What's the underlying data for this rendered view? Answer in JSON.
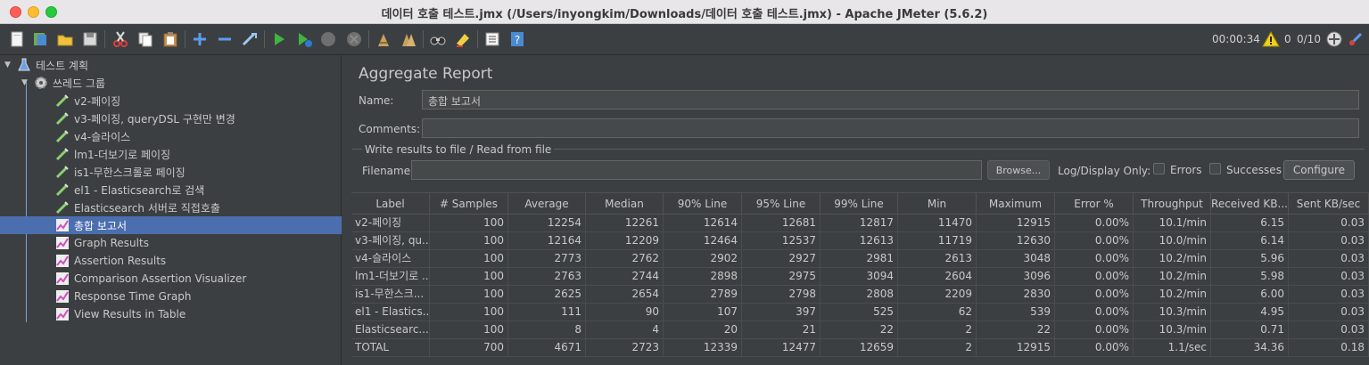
{
  "window": {
    "title": "데이터 호출 테스트.jmx (/Users/inyongkim/Downloads/데이터 호출 테스트.jmx) - Apache JMeter (5.6.2)"
  },
  "toolbar": {
    "timer": "00:00:34",
    "warning_count": "0",
    "threads": "0/10"
  },
  "tree": {
    "items": [
      {
        "label": "테스트 계획",
        "icon": "flask-icon"
      },
      {
        "label": "쓰레드 그룹",
        "icon": "gear-icon"
      },
      {
        "label": "v2-페이징",
        "icon": "sampler-pipette-icon"
      },
      {
        "label": "v3-페이징, queryDSL 구현만 변경",
        "icon": "sampler-pipette-icon"
      },
      {
        "label": "v4-슬라이스",
        "icon": "sampler-pipette-icon"
      },
      {
        "label": "lm1-더보기로 페이징",
        "icon": "sampler-pipette-icon"
      },
      {
        "label": "is1-무한스크롤로 페이징",
        "icon": "sampler-pipette-icon"
      },
      {
        "label": "el1 - Elasticsearch로 검색",
        "icon": "sampler-pipette-icon"
      },
      {
        "label": "Elasticsearch 서버로 직접호출",
        "icon": "sampler-pipette-icon"
      },
      {
        "label": "총합 보고서",
        "icon": "listener-chart-icon"
      },
      {
        "label": "Graph Results",
        "icon": "listener-chart-icon"
      },
      {
        "label": "Assertion Results",
        "icon": "listener-chart-icon"
      },
      {
        "label": "Comparison Assertion Visualizer",
        "icon": "listener-chart-icon"
      },
      {
        "label": "Response Time Graph",
        "icon": "listener-chart-icon"
      },
      {
        "label": "View Results in Table",
        "icon": "listener-chart-icon"
      }
    ]
  },
  "panel": {
    "title": "Aggregate Report",
    "name_label": "Name:",
    "name_value": "총합 보고서",
    "comments_label": "Comments:",
    "comments_value": "",
    "file_group_title": "Write results to file / Read from file",
    "filename_label": "Filename",
    "filename_value": "",
    "browse_label": "Browse...",
    "log_display_label": "Log/Display Only:",
    "errors_label": "Errors",
    "successes_label": "Successes",
    "configure_label": "Configure"
  },
  "table": {
    "headers": [
      "Label",
      "# Samples",
      "Average",
      "Median",
      "90% Line",
      "95% Line",
      "99% Line",
      "Min",
      "Maximum",
      "Error %",
      "Throughput",
      "Received KB...",
      "Sent KB/sec"
    ],
    "rows": [
      [
        "v2-페이징",
        "100",
        "12254",
        "12261",
        "12614",
        "12681",
        "12817",
        "11470",
        "12915",
        "0.00%",
        "10.1/min",
        "6.15",
        "0.03"
      ],
      [
        "v3-페이징, qu...",
        "100",
        "12164",
        "12209",
        "12464",
        "12537",
        "12613",
        "11719",
        "12630",
        "0.00%",
        "10.0/min",
        "6.14",
        "0.03"
      ],
      [
        "v4-슬라이스",
        "100",
        "2773",
        "2762",
        "2902",
        "2927",
        "2981",
        "2613",
        "3048",
        "0.00%",
        "10.2/min",
        "5.96",
        "0.03"
      ],
      [
        "lm1-더보기로 ...",
        "100",
        "2763",
        "2744",
        "2898",
        "2975",
        "3094",
        "2604",
        "3096",
        "0.00%",
        "10.2/min",
        "5.98",
        "0.03"
      ],
      [
        "is1-무한스크...",
        "100",
        "2625",
        "2654",
        "2789",
        "2798",
        "2808",
        "2209",
        "2830",
        "0.00%",
        "10.2/min",
        "6.00",
        "0.03"
      ],
      [
        "el1 - Elastics...",
        "100",
        "111",
        "90",
        "107",
        "397",
        "525",
        "62",
        "539",
        "0.00%",
        "10.3/min",
        "4.95",
        "0.03"
      ],
      [
        "Elasticsearc...",
        "100",
        "8",
        "4",
        "20",
        "21",
        "22",
        "2",
        "22",
        "0.00%",
        "10.3/min",
        "0.71",
        "0.03"
      ],
      [
        "TOTAL",
        "700",
        "4671",
        "2723",
        "12339",
        "12477",
        "12659",
        "2",
        "12915",
        "0.00%",
        "1.1/sec",
        "34.36",
        "0.18"
      ]
    ]
  }
}
